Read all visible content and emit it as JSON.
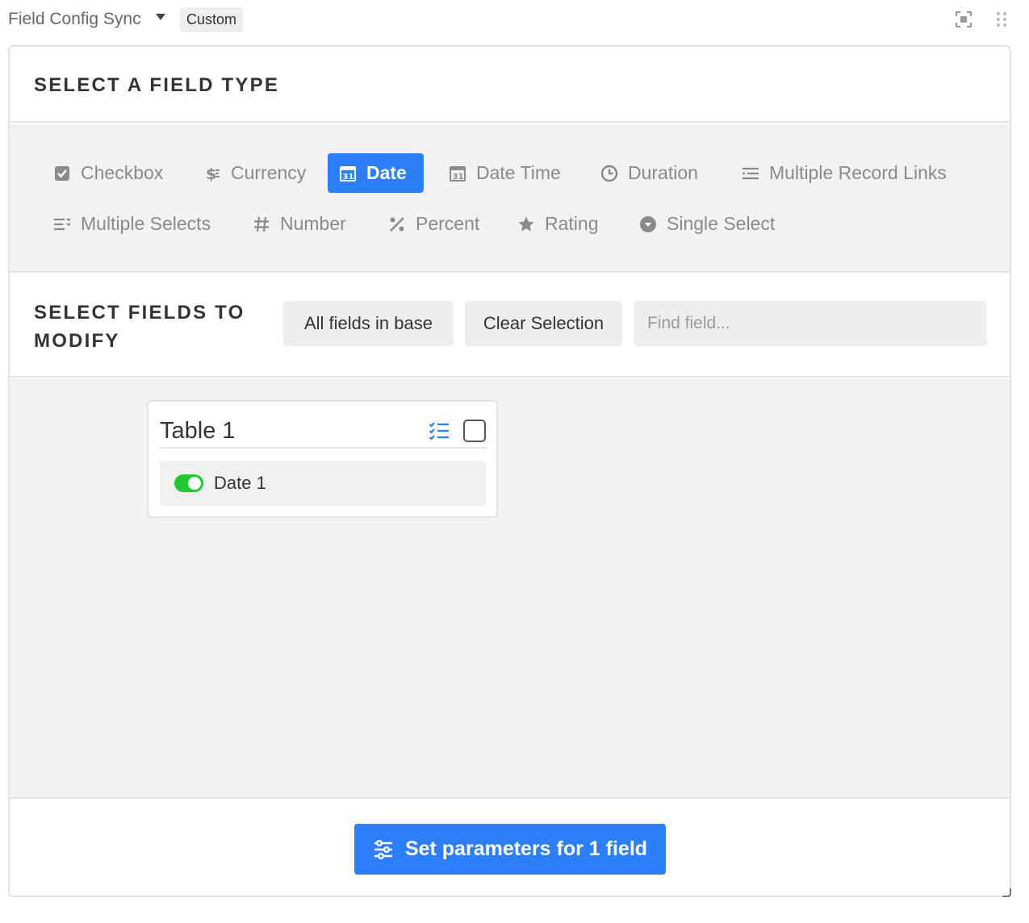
{
  "header": {
    "app_name": "Field Config Sync",
    "badge": "Custom",
    "icons": [
      "expand-icon",
      "drag-handle-icon",
      "chevron-down-icon"
    ]
  },
  "field_type_section": {
    "title": "SELECT A FIELD TYPE",
    "selected": "Date",
    "types": [
      {
        "label": "Checkbox",
        "icon": "checkbox-icon"
      },
      {
        "label": "Currency",
        "icon": "currency-icon"
      },
      {
        "label": "Date",
        "icon": "calendar-icon"
      },
      {
        "label": "Date Time",
        "icon": "calendar-icon"
      },
      {
        "label": "Duration",
        "icon": "clock-icon"
      },
      {
        "label": "Multiple Record Links",
        "icon": "record-links-icon"
      },
      {
        "label": "Multiple Selects",
        "icon": "multiple-selects-icon"
      },
      {
        "label": "Number",
        "icon": "hash-icon"
      },
      {
        "label": "Percent",
        "icon": "percent-icon"
      },
      {
        "label": "Rating",
        "icon": "star-icon"
      },
      {
        "label": "Single Select",
        "icon": "single-select-icon"
      }
    ]
  },
  "fields_section": {
    "title": "SELECT FIELDS TO MODIFY",
    "all_fields_label": "All fields in base",
    "clear_label": "Clear Selection",
    "search_placeholder": "Find field...",
    "search_value": ""
  },
  "tables": [
    {
      "name": "Table 1",
      "checked": false,
      "fields": [
        {
          "name": "Date 1",
          "enabled": true
        }
      ]
    }
  ],
  "colors": {
    "accent": "#2d7ff9",
    "toggle_on": "#20c933"
  },
  "footer": {
    "action_label": "Set parameters for 1 field"
  }
}
